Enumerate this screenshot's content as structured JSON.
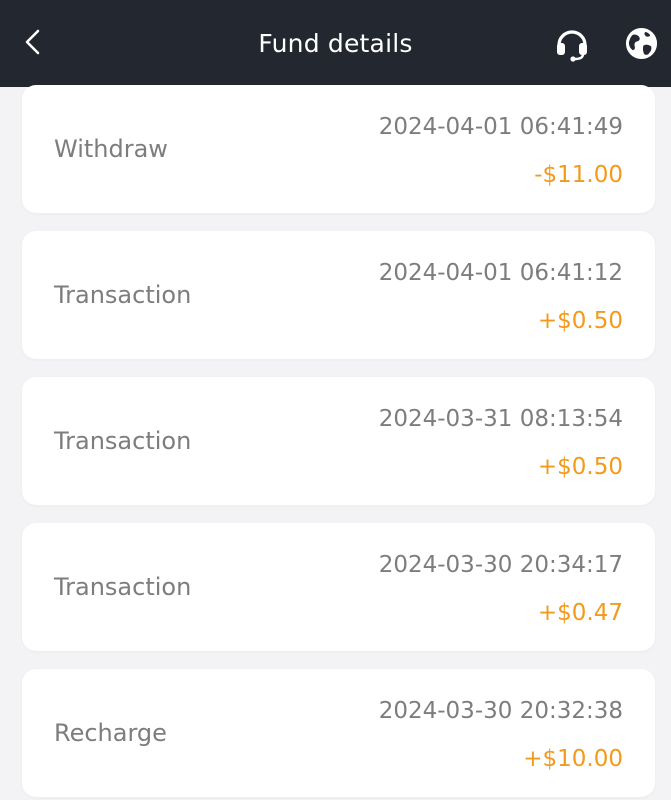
{
  "header": {
    "title": "Fund details",
    "back_icon": "chevron-left-icon",
    "support_icon": "headset-icon",
    "language_icon": "globe-icon",
    "background": "#232830"
  },
  "colors": {
    "amount": "#f39a1c",
    "muted_text": "#7d7d7d",
    "page_bg": "#f3f3f5"
  },
  "records": [
    {
      "type": "Withdraw",
      "time": "2024-04-01 06:41:49",
      "amount": "-$11.00"
    },
    {
      "type": "Transaction",
      "time": "2024-04-01 06:41:12",
      "amount": "+$0.50"
    },
    {
      "type": "Transaction",
      "time": "2024-03-31 08:13:54",
      "amount": "+$0.50"
    },
    {
      "type": "Transaction",
      "time": "2024-03-30 20:34:17",
      "amount": "+$0.47"
    },
    {
      "type": "Recharge",
      "time": "2024-03-30 20:32:38",
      "amount": "+$10.00"
    }
  ]
}
